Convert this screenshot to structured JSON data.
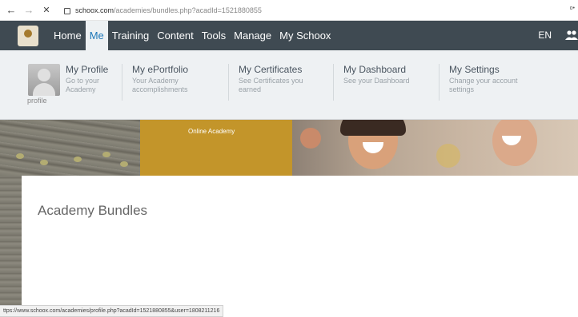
{
  "browser": {
    "back_glyph": "←",
    "forward_glyph": "→",
    "close_glyph": "✕",
    "url_domain": "schoox.com",
    "url_path": "/academies/bundles.php?acadId=1521880855",
    "extension_glyph": "o•"
  },
  "topnav": {
    "items": [
      "Home",
      "Me",
      "Training",
      "Content",
      "Tools",
      "Manage",
      "My Schoox"
    ],
    "active": "Me",
    "language": "EN",
    "people_icon": "people-icon",
    "bg_color": "#3f4a52",
    "accent_color": "#1d77b8"
  },
  "submenu": {
    "profile": {
      "title": "My Profile",
      "desc": "Go to your Academy",
      "desc_tail": "profile"
    },
    "eportfolio": {
      "title": "My ePortfolio",
      "desc": "Your Academy accomplishments"
    },
    "certificates": {
      "title": "My Certificates",
      "desc": "See Certificates you earned"
    },
    "dashboard": {
      "title": "My Dashboard",
      "desc": "See your Dashboard"
    },
    "settings": {
      "title": "My Settings",
      "desc": "Change your account settings"
    }
  },
  "banner": {
    "label": "Online Academy",
    "gold_color": "#c3952a"
  },
  "main": {
    "title": "Academy Bundles"
  },
  "status": {
    "link_preview": "ttps://www.schoox.com/academies/profile.php?acadId=1521880855&user=1808211216"
  }
}
